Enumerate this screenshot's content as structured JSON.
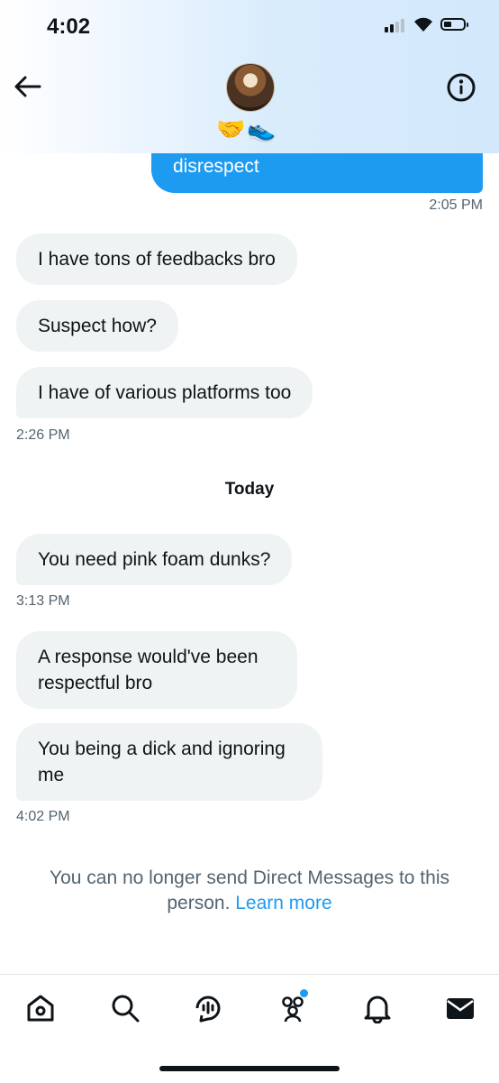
{
  "status_bar": {
    "time": "4:02"
  },
  "header": {
    "back_icon": "arrow-left-icon",
    "info_icon": "info-circle-icon",
    "emoji": "🤝👟"
  },
  "conversation": {
    "sent": {
      "text": "disrespect",
      "timestamp": "2:05 PM"
    },
    "group1": {
      "messages": [
        "I have tons of feedbacks bro",
        "Suspect how?",
        "I have of various platforms too"
      ],
      "timestamp": "2:26 PM"
    },
    "day_divider": "Today",
    "group2": {
      "message": "You need pink foam dunks?",
      "timestamp": "3:13 PM"
    },
    "group3": {
      "messages": [
        "A response would've been respectful bro",
        "You being a dick and ignoring me"
      ],
      "timestamp": "4:02 PM"
    }
  },
  "notice": {
    "text": "You can no longer send Direct Messages to this person.",
    "link": "Learn more"
  },
  "tabbar": {
    "items": [
      "home-icon",
      "search-icon",
      "spaces-icon",
      "communities-icon",
      "notifications-bell-icon",
      "messages-envelope-icon"
    ]
  },
  "colors": {
    "accent": "#1d9bf0",
    "bubble_received": "#eff3f4",
    "muted_text": "#536471"
  }
}
